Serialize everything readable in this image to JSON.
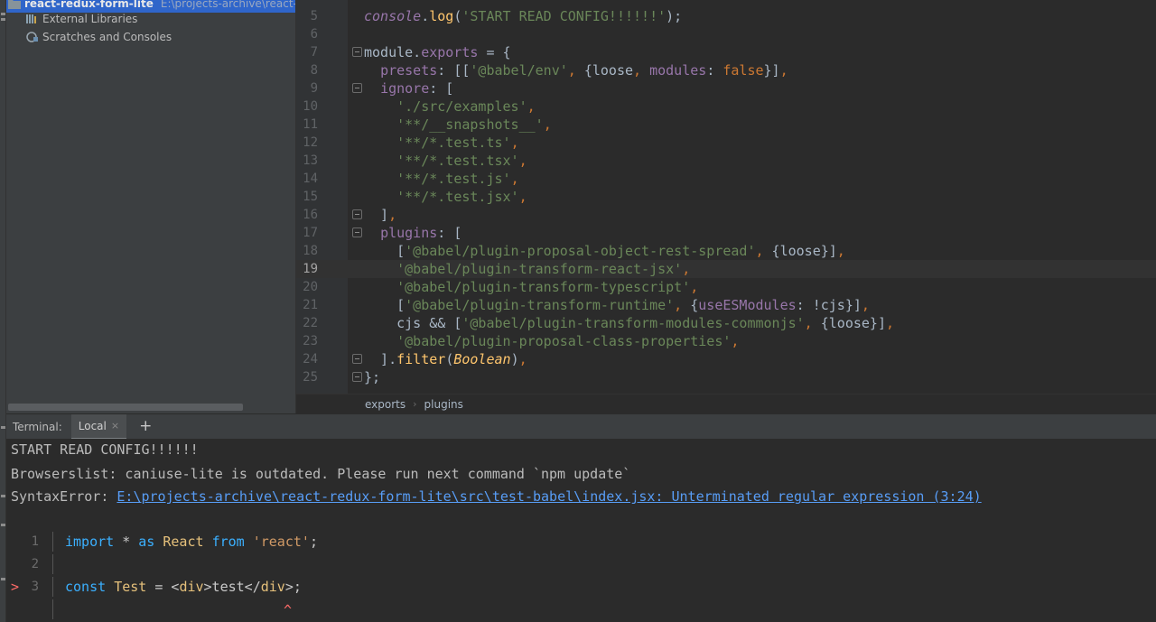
{
  "project": {
    "rows": [
      {
        "name": "react-redux-form-lite",
        "path": "E:\\projects-archive\\react-red",
        "selected": true,
        "icon": "folder-icon"
      },
      {
        "name": "External Libraries",
        "path": "",
        "selected": false,
        "icon": "library-icon"
      },
      {
        "name": "Scratches and Consoles",
        "path": "",
        "selected": false,
        "icon": "scratches-icon"
      }
    ]
  },
  "editor": {
    "lines": [
      {
        "n": "5",
        "fold": false,
        "current": false,
        "tokens": [
          [
            "t-it",
            "console"
          ],
          [
            "t-plain",
            "."
          ],
          [
            "t-call",
            "log"
          ],
          [
            "t-plain",
            "("
          ],
          [
            "t-str",
            "'START READ CONFIG!!!!!!'"
          ],
          [
            "t-plain",
            ");"
          ]
        ]
      },
      {
        "n": "6",
        "fold": false,
        "current": false,
        "tokens": []
      },
      {
        "n": "7",
        "fold": true,
        "current": false,
        "tokens": [
          [
            "t-plain",
            "module."
          ],
          [
            "t-prop",
            "exports"
          ],
          [
            "t-plain",
            " = {"
          ]
        ]
      },
      {
        "n": "8",
        "fold": false,
        "current": false,
        "tokens": [
          [
            "t-plain",
            "  "
          ],
          [
            "t-prop",
            "presets"
          ],
          [
            "t-plain",
            ": [["
          ],
          [
            "t-str",
            "'@babel/env'"
          ],
          [
            "t-kw",
            ","
          ],
          [
            "t-plain",
            " {loose"
          ],
          [
            "t-kw",
            ","
          ],
          [
            "t-plain",
            " "
          ],
          [
            "t-prop",
            "modules"
          ],
          [
            "t-plain",
            ": "
          ],
          [
            "t-kw",
            "false"
          ],
          [
            "t-plain",
            "}]"
          ],
          [
            "t-kw",
            ","
          ]
        ]
      },
      {
        "n": "9",
        "fold": true,
        "current": false,
        "tokens": [
          [
            "t-plain",
            "  "
          ],
          [
            "t-prop",
            "ignore"
          ],
          [
            "t-plain",
            ": ["
          ]
        ]
      },
      {
        "n": "10",
        "fold": false,
        "current": false,
        "tokens": [
          [
            "t-plain",
            "    "
          ],
          [
            "t-str",
            "'./src/examples'"
          ],
          [
            "t-kw",
            ","
          ]
        ]
      },
      {
        "n": "11",
        "fold": false,
        "current": false,
        "tokens": [
          [
            "t-plain",
            "    "
          ],
          [
            "t-str",
            "'**/__snapshots__'"
          ],
          [
            "t-kw",
            ","
          ]
        ]
      },
      {
        "n": "12",
        "fold": false,
        "current": false,
        "tokens": [
          [
            "t-plain",
            "    "
          ],
          [
            "t-str",
            "'**/*.test.ts'"
          ],
          [
            "t-kw",
            ","
          ]
        ]
      },
      {
        "n": "13",
        "fold": false,
        "current": false,
        "tokens": [
          [
            "t-plain",
            "    "
          ],
          [
            "t-str",
            "'**/*.test.tsx'"
          ],
          [
            "t-kw",
            ","
          ]
        ]
      },
      {
        "n": "14",
        "fold": false,
        "current": false,
        "tokens": [
          [
            "t-plain",
            "    "
          ],
          [
            "t-str",
            "'**/*.test.js'"
          ],
          [
            "t-kw",
            ","
          ]
        ]
      },
      {
        "n": "15",
        "fold": false,
        "current": false,
        "tokens": [
          [
            "t-plain",
            "    "
          ],
          [
            "t-str",
            "'**/*.test.jsx'"
          ],
          [
            "t-kw",
            ","
          ]
        ]
      },
      {
        "n": "16",
        "fold": true,
        "current": false,
        "tokens": [
          [
            "t-plain",
            "  ]"
          ],
          [
            "t-kw",
            ","
          ]
        ]
      },
      {
        "n": "17",
        "fold": true,
        "current": false,
        "tokens": [
          [
            "t-plain",
            "  "
          ],
          [
            "t-prop",
            "plugins"
          ],
          [
            "t-plain",
            ": ["
          ]
        ]
      },
      {
        "n": "18",
        "fold": false,
        "current": false,
        "tokens": [
          [
            "t-plain",
            "    ["
          ],
          [
            "t-str",
            "'@babel/plugin-proposal-object-rest-spread'"
          ],
          [
            "t-kw",
            ","
          ],
          [
            "t-plain",
            " {loose}]"
          ],
          [
            "t-kw",
            ","
          ]
        ]
      },
      {
        "n": "19",
        "fold": false,
        "current": true,
        "tokens": [
          [
            "t-plain",
            "    "
          ],
          [
            "t-str",
            "'@babel/plugin-transform-react-jsx'"
          ],
          [
            "t-kw",
            ","
          ]
        ]
      },
      {
        "n": "20",
        "fold": false,
        "current": false,
        "tokens": [
          [
            "t-plain",
            "    "
          ],
          [
            "t-str",
            "'@babel/plugin-transform-typescript'"
          ],
          [
            "t-kw",
            ","
          ]
        ]
      },
      {
        "n": "21",
        "fold": false,
        "current": false,
        "tokens": [
          [
            "t-plain",
            "    ["
          ],
          [
            "t-str",
            "'@babel/plugin-transform-runtime'"
          ],
          [
            "t-kw",
            ","
          ],
          [
            "t-plain",
            " {"
          ],
          [
            "t-prop",
            "useESModules"
          ],
          [
            "t-plain",
            ": !cjs}]"
          ],
          [
            "t-kw",
            ","
          ]
        ]
      },
      {
        "n": "22",
        "fold": false,
        "current": false,
        "tokens": [
          [
            "t-plain",
            "    cjs && ["
          ],
          [
            "t-str",
            "'@babel/plugin-transform-modules-commonjs'"
          ],
          [
            "t-kw",
            ","
          ],
          [
            "t-plain",
            " {loose}]"
          ],
          [
            "t-kw",
            ","
          ]
        ]
      },
      {
        "n": "23",
        "fold": false,
        "current": false,
        "tokens": [
          [
            "t-plain",
            "    "
          ],
          [
            "t-str",
            "'@babel/plugin-proposal-class-properties'"
          ],
          [
            "t-kw",
            ","
          ]
        ]
      },
      {
        "n": "24",
        "fold": true,
        "current": false,
        "tokens": [
          [
            "t-plain",
            "  ]."
          ],
          [
            "t-call",
            "filter"
          ],
          [
            "t-plain",
            "("
          ],
          [
            "t-it2",
            "Boolean"
          ],
          [
            "t-plain",
            ")"
          ],
          [
            "t-kw",
            ","
          ]
        ]
      },
      {
        "n": "25",
        "fold": true,
        "current": false,
        "tokens": [
          [
            "t-plain",
            "};"
          ]
        ]
      }
    ]
  },
  "breadcrumbs": [
    "exports",
    "plugins"
  ],
  "terminal": {
    "label": "Terminal:",
    "tab": "Local",
    "close_glyph": "×",
    "add_glyph": "+",
    "output": [
      "START READ CONFIG!!!!!!",
      "Browserslist: caniuse-lite is outdated. Please run next command `npm update`"
    ],
    "error_prefix": "SyntaxError: ",
    "error_link": "E:\\projects-archive\\react-redux-form-lite\\src\\test-babel\\index.jsx: Unterminated regular expression (3:24)",
    "frame": [
      {
        "arrow": "",
        "n": "1",
        "tokens": [
          [
            "s-kw",
            "import"
          ],
          [
            "s-op",
            " * "
          ],
          [
            "s-kw",
            "as"
          ],
          [
            "s-op",
            " "
          ],
          [
            "s-id",
            "React"
          ],
          [
            "s-op",
            " "
          ],
          [
            "s-kw",
            "from"
          ],
          [
            "s-op",
            " "
          ],
          [
            "s-str",
            "'react'"
          ],
          [
            "s-op",
            ";"
          ]
        ]
      },
      {
        "arrow": "",
        "n": "2",
        "tokens": []
      },
      {
        "arrow": ">",
        "n": "3",
        "tokens": [
          [
            "s-kw",
            "const"
          ],
          [
            "s-op",
            " "
          ],
          [
            "s-id",
            "Test"
          ],
          [
            "s-op",
            " = <"
          ],
          [
            "s-id",
            "div"
          ],
          [
            "s-op",
            ">test</"
          ],
          [
            "s-id",
            "div"
          ],
          [
            "s-op",
            ">;"
          ]
        ]
      },
      {
        "arrow": "",
        "n": "",
        "tokens": []
      }
    ],
    "caret": "^"
  },
  "colors": {
    "background": "#2b2b2b",
    "panel": "#3c3f41",
    "selection": "#2f65ca",
    "link": "#589df6",
    "error": "#ff6b68"
  }
}
